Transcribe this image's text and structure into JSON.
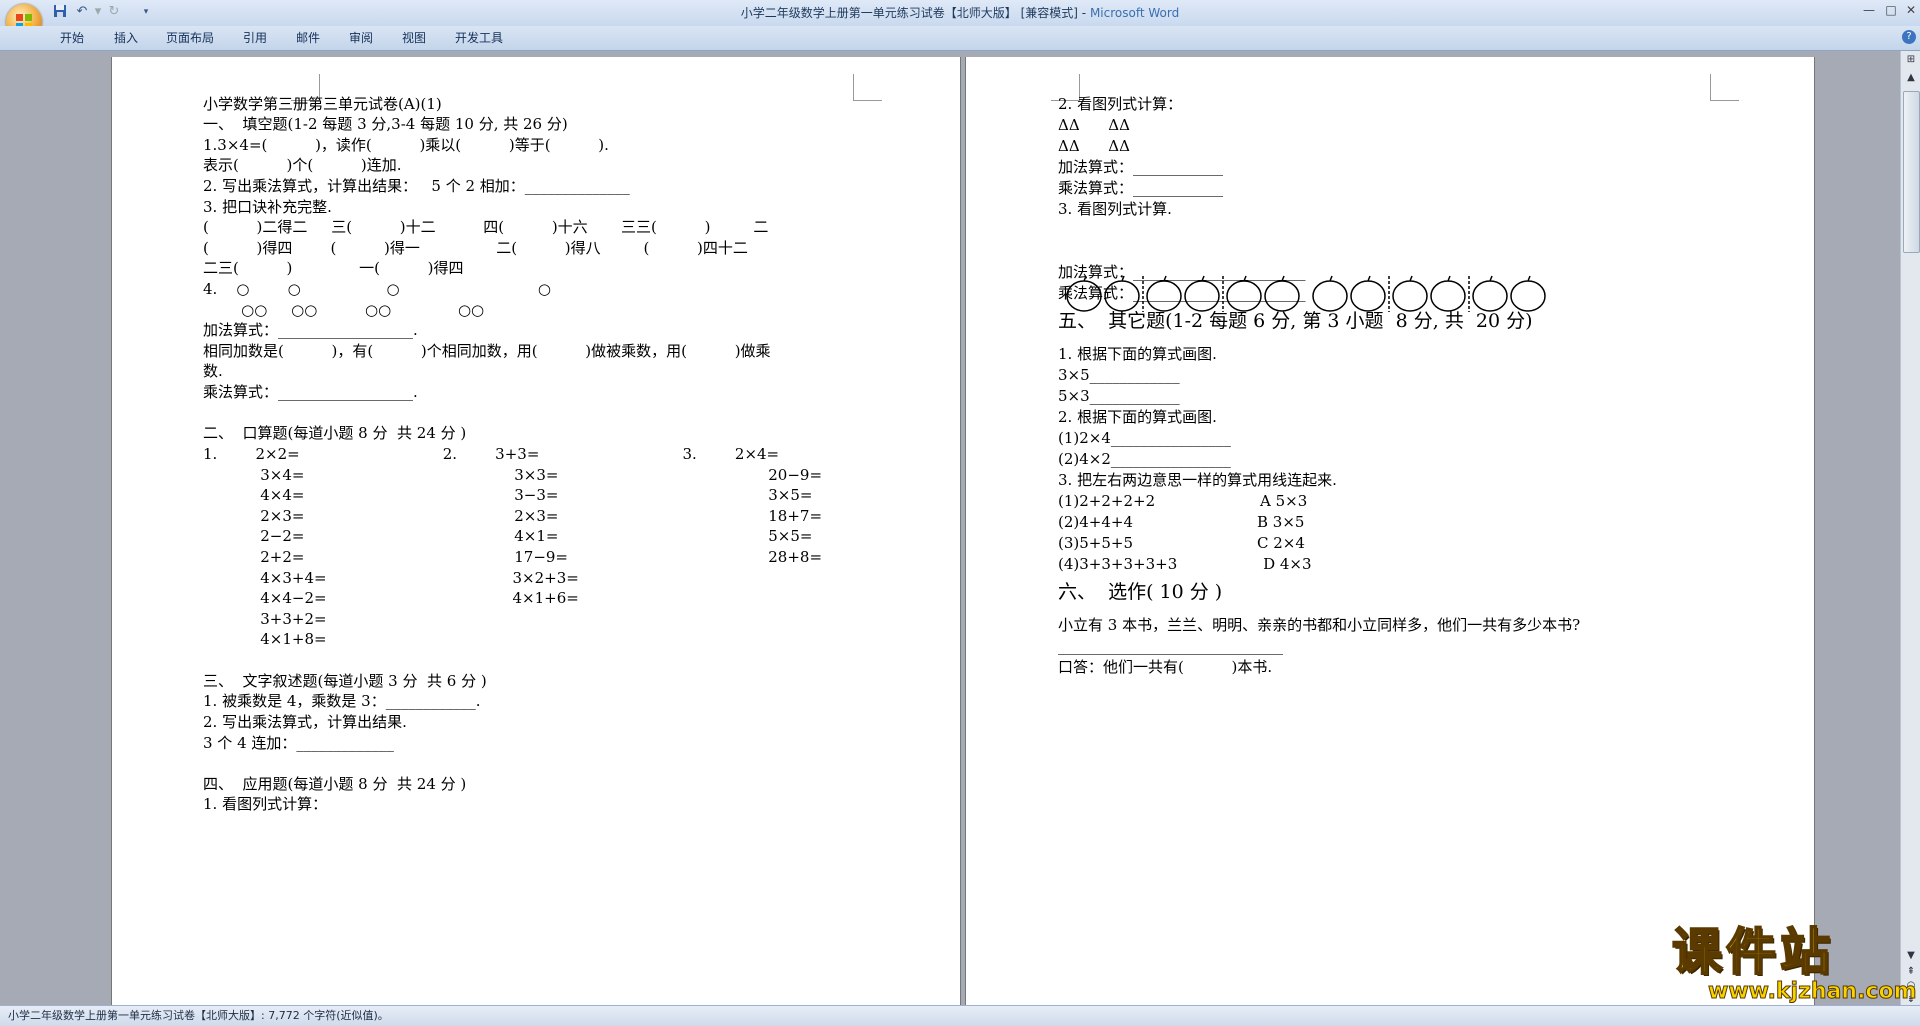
{
  "window": {
    "title": "小学二年级数学上册第一单元练习试卷【北师大版】 [兼容模式]",
    "app_name": "Microsoft Word",
    "title_separator": " - "
  },
  "ribbon": {
    "tabs": [
      "开始",
      "插入",
      "页面布局",
      "引用",
      "邮件",
      "审阅",
      "视图",
      "开发工具"
    ]
  },
  "status_bar": {
    "text": "小学二年级数学上册第一单元练习试卷【北师大版】: 7,772 个字符(近似值)。"
  },
  "watermark": {
    "main": "课件站",
    "url": "www.kjzhan.com"
  },
  "document": {
    "page1": [
      "小学数学第三册第三单元试卷(A)(1)",
      "一、  填空题(1-2 每题 3 分,3-4 每题 10 分, 共 26 分)",
      "1.3×4=(          )，读作(          )乘以(          )等于(          ).",
      "表示(          )个(          )连加.",
      "2. 写出乘法算式，计算出结果：   5 个 2 相加：______________",
      "3. 把口诀补充完整.",
      "(          )二得二     三(          )十二          四(          )十六       三三(          )         二",
      "(          )得四        (          )得一                二(          )得八         (          )四十二",
      "二三(          )              一(          )得四",
      "4.    ○        ○                  ○                             ○",
      "        ○○     ○○          ○○              ○○",
      "加法算式：__________________.",
      "相同加数是(          )，有(          )个相同加数，用(          )做被乘数，用(          )做乘",
      "数.",
      "乘法算式：__________________.",
      "",
      "二、  口算题(每道小题 8 分  共 24 分 )",
      "1.        2×2=                              2.        3+3=                              3.        2×4=",
      "            3×4=                                            3×3=                                            20−9=",
      "            4×4=                                            3−3=                                            3×5=",
      "            2×3=                                            2×3=                                            18+7=",
      "            2−2=                                            4×1=                                            5×5=",
      "            2+2=                                            17−9=                                          28+8=",
      "            4×3+4=                                       3×2+3=",
      "            4×4−2=                                       4×1+6=",
      "            3+3+2=",
      "            4×1+8=",
      "",
      "三、  文字叙述题(每道小题 3 分  共 6 分 )",
      "1. 被乘数是 4，乘数是 3：____________.",
      "2. 写出乘法算式，计算出结果.",
      "3 个 4 连加：_____________",
      "",
      "四、  应用题(每道小题 8 分  共 24 分 )",
      "1. 看图列式计算："
    ],
    "page2": [
      "2. 看图列式计算：",
      "ΔΔ      ΔΔ",
      "ΔΔ      ΔΔ",
      "加法算式：____________",
      "乘法算式：____________",
      "3. 看图列式计算.",
      "",
      "加法算式：_______________________",
      "乘法算式：_______________________",
      "五、  其它题(1-2 每题 6 分, 第 3 小题  8 分, 共  20 分)",
      "1. 根据下面的算式画图.",
      "3×5____________",
      "5×3____________",
      "2. 根据下面的算式画图.",
      "(1)2×4________________",
      "(2)4×2________________",
      "3. 把左右两边意思一样的算式用线连起来.",
      "(1)2+2+2+2                      A 5×3",
      "(2)4+4+4                          B 3×5",
      "(3)5+5+5                          C 2×4",
      "(4)3+3+3+3+3                  D 4×3",
      "六、  选作( 10 分 )",
      "小立有 3 本书，兰兰、明明、亲亲的书都和小立同样多，他们一共有多少本书?",
      "______________________________",
      "口答：他们一共有(          )本书.",
      ""
    ]
  }
}
